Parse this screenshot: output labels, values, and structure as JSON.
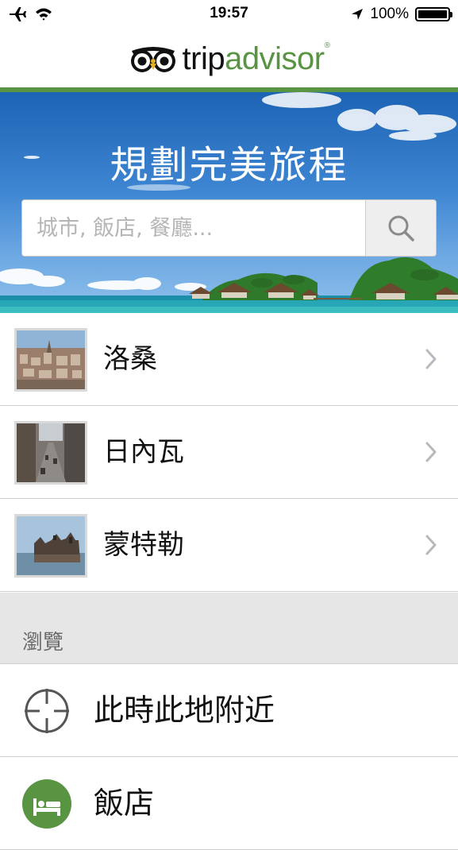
{
  "status_bar": {
    "time": "19:57",
    "battery_text": "100%",
    "icons": [
      "airplane-icon",
      "wifi-icon",
      "location-arrow-icon",
      "battery-icon"
    ]
  },
  "header": {
    "logo_trip": "trip",
    "logo_advisor": "advisor",
    "logo_reg": "®",
    "brand_color": "#589442"
  },
  "hero": {
    "title": "規劃完美旅程",
    "search_placeholder": "城市, 飯店, 餐廳..."
  },
  "recent": [
    {
      "label": "洛桑"
    },
    {
      "label": "日內瓦"
    },
    {
      "label": "蒙特勒"
    }
  ],
  "browse_section": {
    "label": "瀏覽",
    "items": [
      {
        "label": "此時此地附近",
        "icon": "crosshair-icon"
      },
      {
        "label": "飯店",
        "icon": "bed-icon"
      }
    ]
  }
}
